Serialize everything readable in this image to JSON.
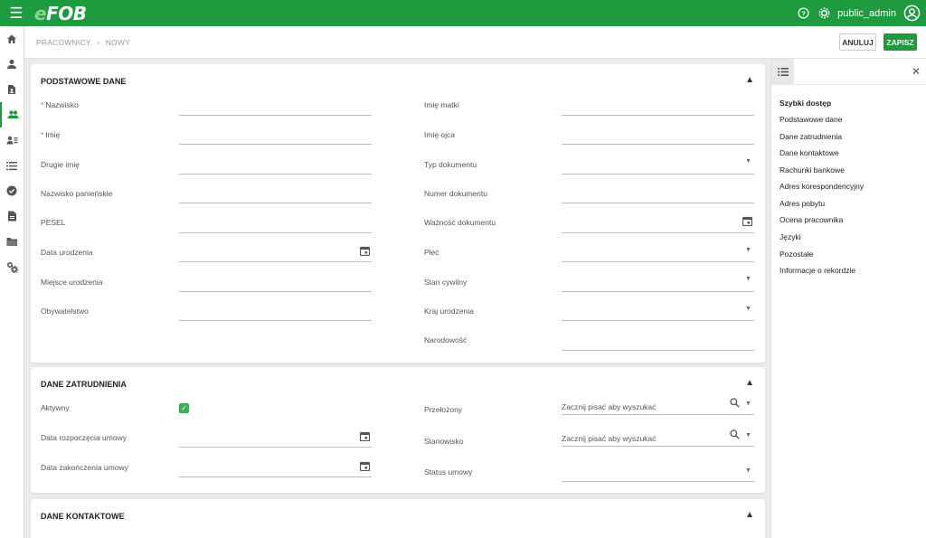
{
  "app": {
    "logo_e": "e",
    "logo_rest": "FOB",
    "user": "public_admin"
  },
  "breadcrumb": [
    "PRACOWNICY",
    "›",
    "NOWY"
  ],
  "actions": {
    "cancel": "ANULUJ",
    "save": "ZAPISZ"
  },
  "sections": {
    "basic": {
      "title": "PODSTAWOWE DANE",
      "left": [
        "Nazwisko",
        "Imię",
        "Drugie imię",
        "Nazwisko panieńskie",
        "PESEL",
        "Data urodzenia",
        "Miejsce urodzenia",
        "Obywatelstwo"
      ],
      "right": [
        "Imię matki",
        "Imię ojca",
        "Typ dokumentu",
        "Numer dokumentu",
        "Ważność dokumentu",
        "Płeć",
        "Stan cywilny",
        "Kraj urodzenia",
        "Narodowość"
      ]
    },
    "employment": {
      "title": "DANE ZATRUDNIENIA",
      "left": [
        "Aktywny",
        "Data rozpoczęcia umowy",
        "Data zakończenia umowy"
      ],
      "right": [
        "Przełożony",
        "Stanowisko",
        "Status umowy"
      ],
      "search_placeholder": "Zacznij pisać aby wyszukać",
      "active_checked": true
    },
    "contact": {
      "title": "DANE KONTAKTOWE"
    }
  },
  "quick_access": {
    "title": "Szybki dostęp",
    "items": [
      "Podstawowe dane",
      "Dane zatrudnienia",
      "Dane kontaktowe",
      "Rachunki bankowe",
      "Adres korespondencyjny",
      "Adres pobytu",
      "Ocena pracownika",
      "Języki",
      "Pozostałe",
      "Informacje o rekordzie"
    ]
  },
  "icons": {
    "brand": "#1e9b3f",
    "required": "#e05a1a"
  }
}
